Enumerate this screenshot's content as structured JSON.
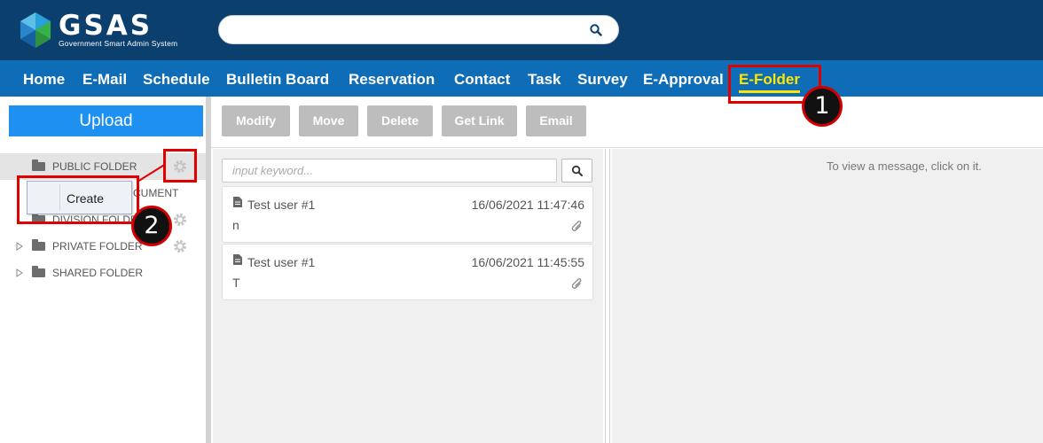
{
  "app": {
    "logo_title": "GSAS",
    "logo_subtitle": "Government Smart Admin System"
  },
  "colors": {
    "topbar": "#0b3f6e",
    "nav": "#0e6db6",
    "active_nav": "#ffe600",
    "upload": "#1e90f0",
    "annotation": "#e00000"
  },
  "nav": {
    "items": [
      {
        "label": "Home"
      },
      {
        "label": "E-Mail"
      },
      {
        "label": "Schedule"
      },
      {
        "label": "Bulletin Board"
      },
      {
        "label": "Reservation"
      },
      {
        "label": "Contact"
      },
      {
        "label": "Task"
      },
      {
        "label": "Survey"
      },
      {
        "label": "E-Approval"
      },
      {
        "label": "E-Folder",
        "active": true
      }
    ]
  },
  "sidebar": {
    "upload_label": "Upload",
    "folders": [
      {
        "label": "PUBLIC FOLDER",
        "selected": true
      },
      {
        "label": "CUMENT"
      },
      {
        "label": "DIVISION FOLDE"
      },
      {
        "label": "PRIVATE FOLDER"
      },
      {
        "label": "SHARED FOLDER"
      }
    ],
    "context_menu": {
      "create_label": "Create"
    }
  },
  "toolbar": {
    "modify_label": "Modify",
    "move_label": "Move",
    "delete_label": "Delete",
    "get_link_label": "Get Link",
    "email_label": "Email"
  },
  "list": {
    "search_placeholder": "input keyword...",
    "messages": [
      {
        "sender": "Test user #1",
        "date": "16/06/2021 11:47:46",
        "preview": "n",
        "has_attachment": true
      },
      {
        "sender": "Test user #1",
        "date": "16/06/2021 11:45:55",
        "preview": "T",
        "has_attachment": true
      }
    ]
  },
  "viewer": {
    "empty_message": "To view a message, click on it."
  },
  "annotations": {
    "step1": "1",
    "step2": "2"
  }
}
